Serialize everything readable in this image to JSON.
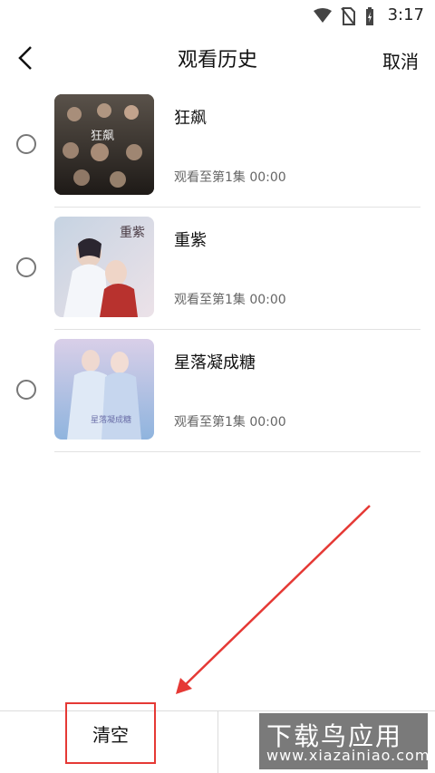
{
  "status": {
    "time": "3:17"
  },
  "header": {
    "title": "观看历史",
    "cancel": "取消"
  },
  "history": [
    {
      "name": "狂飙",
      "progress": "观看至第1集  00:00",
      "poster_text": "狂飙"
    },
    {
      "name": "重紫",
      "progress": "观看至第1集  00:00",
      "poster_text": "重紫"
    },
    {
      "name": "星落凝成糖",
      "progress": "观看至第1集  00:00",
      "poster_text": "星落凝成糖"
    }
  ],
  "footer": {
    "clear": "清空"
  },
  "watermark": {
    "title": "下载鸟应用",
    "url": "www.xiazainiao.com"
  },
  "colors": {
    "accent": "#e53935",
    "divider": "#e2e2e2"
  }
}
